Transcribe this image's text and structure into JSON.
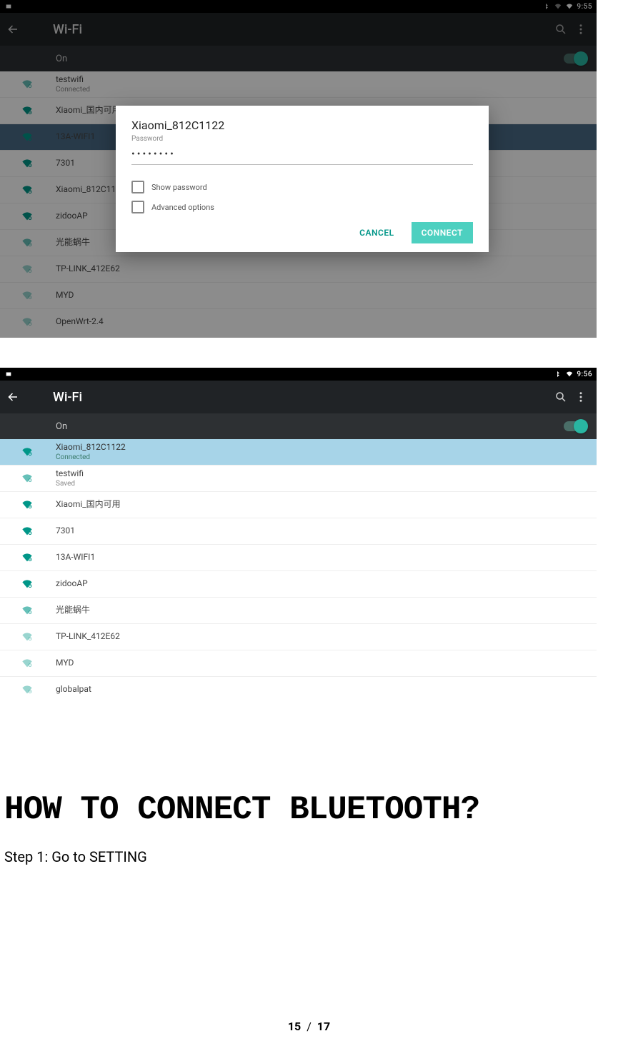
{
  "screenshot1": {
    "status_time": "9:55",
    "appbar_title": "Wi-Fi",
    "toggle_label": "On",
    "networks": [
      {
        "ssid": "testwifi",
        "sub": "Connected",
        "strength": 3
      },
      {
        "ssid": "Xiaomi_国内可用",
        "sub": "",
        "strength": 4
      },
      {
        "ssid": "13A-WIFI1",
        "sub": "",
        "strength": 4,
        "selected": true
      },
      {
        "ssid": "7301",
        "sub": "",
        "strength": 4
      },
      {
        "ssid": "Xiaomi_812C1122",
        "sub": "",
        "strength": 4
      },
      {
        "ssid": "zidooAP",
        "sub": "",
        "strength": 4
      },
      {
        "ssid": "光能蜗牛",
        "sub": "",
        "strength": 3
      },
      {
        "ssid": "TP-LINK_412E62",
        "sub": "",
        "strength": 2
      },
      {
        "ssid": "MYD",
        "sub": "",
        "strength": 2
      },
      {
        "ssid": "OpenWrt-2.4",
        "sub": "",
        "strength": 2
      }
    ],
    "dialog": {
      "title": "Xiaomi_812C1122",
      "password_label": "Password",
      "password_value": "••••••••",
      "show_password_label": "Show password",
      "advanced_label": "Advanced options",
      "cancel_label": "CANCEL",
      "connect_label": "CONNECT"
    }
  },
  "screenshot2": {
    "status_time": "9:56",
    "appbar_title": "Wi-Fi",
    "toggle_label": "On",
    "networks": [
      {
        "ssid": "Xiaomi_812C1122",
        "sub": "Connected",
        "strength": 4,
        "connected": true
      },
      {
        "ssid": "testwifi",
        "sub": "Saved",
        "strength": 3
      },
      {
        "ssid": "Xiaomi_国内可用",
        "sub": "",
        "strength": 4
      },
      {
        "ssid": "7301",
        "sub": "",
        "strength": 4
      },
      {
        "ssid": "13A-WIFI1",
        "sub": "",
        "strength": 4
      },
      {
        "ssid": "zidooAP",
        "sub": "",
        "strength": 4
      },
      {
        "ssid": "光能蜗牛",
        "sub": "",
        "strength": 3
      },
      {
        "ssid": "TP-LINK_412E62",
        "sub": "",
        "strength": 2
      },
      {
        "ssid": "MYD",
        "sub": "",
        "strength": 2
      },
      {
        "ssid": "globalpat",
        "sub": "",
        "strength": 2
      }
    ]
  },
  "doc": {
    "heading": "HOW TO CONNECT BLUETOOTH?",
    "step1": "Step 1: Go to SETTING",
    "page_current": "15",
    "page_sep": "/",
    "page_total": "17"
  }
}
